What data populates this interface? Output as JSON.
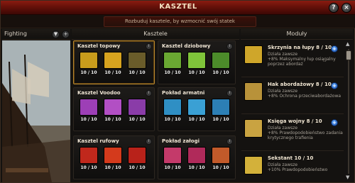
{
  "window": {
    "title": "KASZTEL",
    "help_label": "?",
    "close_label": "×"
  },
  "subtitle": "Rozbuduj kasztele, by wzmocnić swój statek",
  "left": {
    "title": "Fighting",
    "dropdown_icon": "▼",
    "add_icon": "+"
  },
  "center": {
    "title": "Kasztele"
  },
  "right": {
    "title": "Moduły"
  },
  "castles": [
    {
      "title": "Kasztel topowy",
      "slots": [
        "10 / 10",
        "10 / 10",
        "10 / 10"
      ],
      "icon_colors": [
        "#c89c1c",
        "#d7a31f",
        "#6a5c2a"
      ]
    },
    {
      "title": "Kasztel dziobowy",
      "slots": [
        "10 / 10",
        "10 / 10",
        "10 / 10"
      ],
      "icon_colors": [
        "#6aa832",
        "#7fc43a",
        "#4c8c2a"
      ]
    },
    {
      "title": "Kasztel Voodoo",
      "slots": [
        "10 / 10",
        "10 / 10",
        "10 / 10"
      ],
      "icon_colors": [
        "#9d3fb6",
        "#b24fc4",
        "#8a3ca8"
      ]
    },
    {
      "title": "Pokład armatni",
      "slots": [
        "10 / 10",
        "10 / 10",
        "10 / 10"
      ],
      "icon_colors": [
        "#2f8fc4",
        "#3aa0d4",
        "#2c7fb5"
      ]
    },
    {
      "title": "Kasztel rufowy",
      "slots": [
        "10 / 10",
        "10 / 10",
        "10 / 10"
      ],
      "icon_colors": [
        "#c0281c",
        "#d43a1c",
        "#b8221a"
      ]
    },
    {
      "title": "Pokład załogi",
      "slots": [
        "10 / 10",
        "10 / 10",
        "10 / 10"
      ],
      "icon_colors": [
        "#c43a6a",
        "#b02a5a",
        "#c25a2a"
      ]
    }
  ],
  "modules": [
    {
      "name": "Skrzynia na łupy 8 / 10",
      "line1": "Działa zawsze",
      "line2": "+8% Maksymalny łup osiągalny",
      "line3": "poprzez abordaż",
      "icon_color": "#cfa62a",
      "upgrade_label": "+"
    },
    {
      "name": "Hak abordażowy 8 / 10",
      "line1": "Działa zawsze",
      "line2": "+8% Ochrona przeciwabordażowa",
      "line3": "",
      "icon_color": "#b8923a",
      "upgrade_label": "+"
    },
    {
      "name": "Księga wojny 8 / 10",
      "line1": "Działa zawsze",
      "line2": "+8% Prawdopodobieństwo zadania",
      "line3": "krytycznego trafienia",
      "icon_color": "#c9a341",
      "upgrade_label": "+"
    },
    {
      "name": "Sekstant 10 / 10",
      "line1": "Działa zawsze",
      "line2": "+10% Prawdopodobieństwo",
      "line3": "",
      "icon_color": "#d3b13a",
      "upgrade_label": ""
    }
  ]
}
